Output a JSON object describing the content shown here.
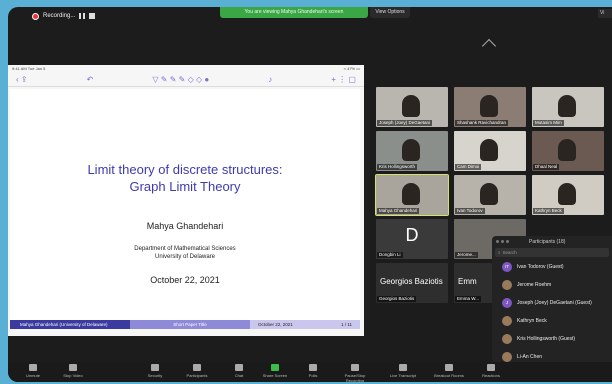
{
  "topbar": {
    "recording_label": "Recording...",
    "viewing_banner": "You are viewing Mahya Ghandehari's screen",
    "view_options": "View Options",
    "corner_label": "Vi"
  },
  "ipad": {
    "status_time": "9:41 AM  Tue Jan 5",
    "status_right": "≈ 47% ▭",
    "tool_icons": "▽ ✎ ✎ ✎ ◇ ◇ ●"
  },
  "slide": {
    "title_line1": "Limit theory of discrete structures:",
    "title_line2": "Graph Limit Theory",
    "author": "Mahya Ghandehari",
    "dept_line1": "Department of Mathematical Sciences",
    "dept_line2": "University of Delaware",
    "date": "October 22, 2021",
    "footer_author": "Mahya Ghandehari (University of Delaware)",
    "footer_title": "Short Paper Title",
    "footer_date": "October 22, 2021",
    "footer_page": "1 / 11"
  },
  "gallery": [
    {
      "name": "Joseph (Joey) DeGaetani"
    },
    {
      "name": "Shashank Ravichandran"
    },
    {
      "name": "Mutasim Mim"
    },
    {
      "name": "Kris Hollingsworth"
    },
    {
      "name": "Cam Dimoi"
    },
    {
      "name": "Dhaal Neal"
    },
    {
      "name": "Mahya Ghandehari"
    },
    {
      "name": "Ivan Todorov"
    },
    {
      "name": "Kathryn Beck"
    },
    {
      "name": "Dongbin Li"
    },
    {
      "name": "Jerome..."
    },
    {
      "name": "Georgios Baziotis"
    },
    {
      "name": "Emma W..."
    }
  ],
  "gallery_extra": {
    "d_letter": "D",
    "big_name_1": "Georgios Baziotis",
    "big_name_2": "Emm"
  },
  "participants": {
    "title": "Participants (18)",
    "search_placeholder": "Search",
    "list": [
      {
        "initials": "IT",
        "name": "Ivan Todorov (Guest)"
      },
      {
        "initials": "",
        "name": "Jerome Roehm"
      },
      {
        "initials": "J",
        "name": "Joseph (Joey) DeGaetani (Guest)"
      },
      {
        "initials": "",
        "name": "Kathryn Beck"
      },
      {
        "initials": "",
        "name": "Kris Hollingsworth (Guest)"
      },
      {
        "initials": "",
        "name": "Li-An Chen"
      }
    ]
  },
  "toolbar": {
    "items": [
      "Unmute",
      "Stop Video",
      "Security",
      "Participants",
      "Chat",
      "Share Screen",
      "Polls",
      "Pause/Stop Recording",
      "Live Transcript",
      "Breakout Rooms",
      "Reactions"
    ]
  },
  "colors": {
    "accent_green": "#3aa645",
    "slide_title": "#3d3bb0",
    "background": "#5ab0d4"
  }
}
